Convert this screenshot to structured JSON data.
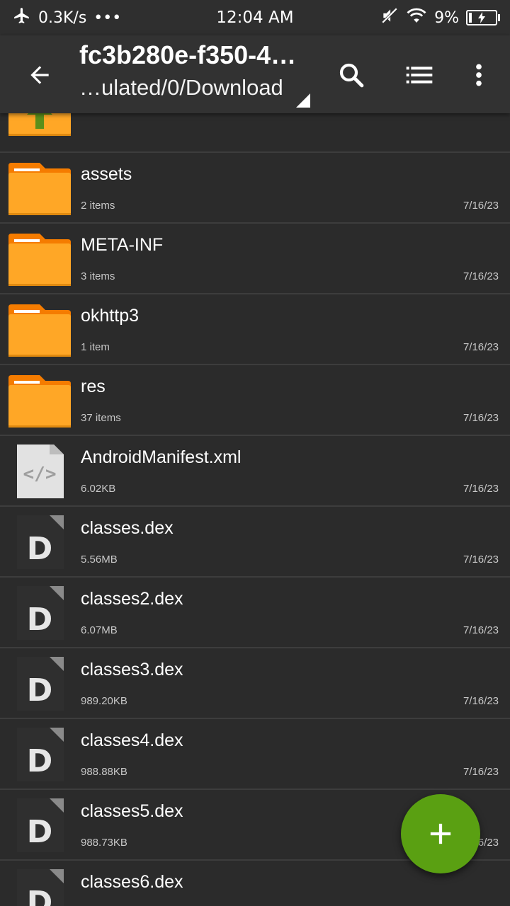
{
  "status_bar": {
    "speed": "0.3K/s",
    "dots": "•••",
    "time": "12:04 AM",
    "battery_pct": "9%",
    "battery_level": 0.09,
    "icons": [
      "airplane-icon",
      "muted-icon",
      "wifi-icon",
      "battery-charging-icon"
    ]
  },
  "app_bar": {
    "title": "fc3b280e-f350-4…",
    "path": "…ulated/0/Download",
    "icons": [
      "back-arrow-icon",
      "search-icon",
      "list-view-icon",
      "more-vert-icon"
    ]
  },
  "files": [
    {
      "kind": "parent-folder",
      "name": "",
      "meta": "",
      "date": ""
    },
    {
      "kind": "folder",
      "name": "assets",
      "meta": "2 items",
      "date": "7/16/23"
    },
    {
      "kind": "folder",
      "name": "META-INF",
      "meta": "3 items",
      "date": "7/16/23"
    },
    {
      "kind": "folder",
      "name": "okhttp3",
      "meta": "1 item",
      "date": "7/16/23"
    },
    {
      "kind": "folder",
      "name": "res",
      "meta": "37 items",
      "date": "7/16/23"
    },
    {
      "kind": "xml",
      "name": "AndroidManifest.xml",
      "meta": "6.02KB",
      "date": "7/16/23"
    },
    {
      "kind": "dex",
      "name": "classes.dex",
      "meta": "5.56MB",
      "date": "7/16/23"
    },
    {
      "kind": "dex",
      "name": "classes2.dex",
      "meta": "6.07MB",
      "date": "7/16/23"
    },
    {
      "kind": "dex",
      "name": "classes3.dex",
      "meta": "989.20KB",
      "date": "7/16/23"
    },
    {
      "kind": "dex",
      "name": "classes4.dex",
      "meta": "988.88KB",
      "date": "7/16/23"
    },
    {
      "kind": "dex",
      "name": "classes5.dex",
      "meta": "988.73KB",
      "date": "7/16/23"
    },
    {
      "kind": "dex",
      "name": "classes6.dex",
      "meta": "",
      "date": ""
    }
  ],
  "fab": {
    "icon": "plus-icon",
    "color": "#5aa012"
  },
  "colors": {
    "folder": "#ffa726",
    "folder_tab": "#f57c00",
    "background": "#2b2b2b",
    "app_bar": "#323232"
  }
}
